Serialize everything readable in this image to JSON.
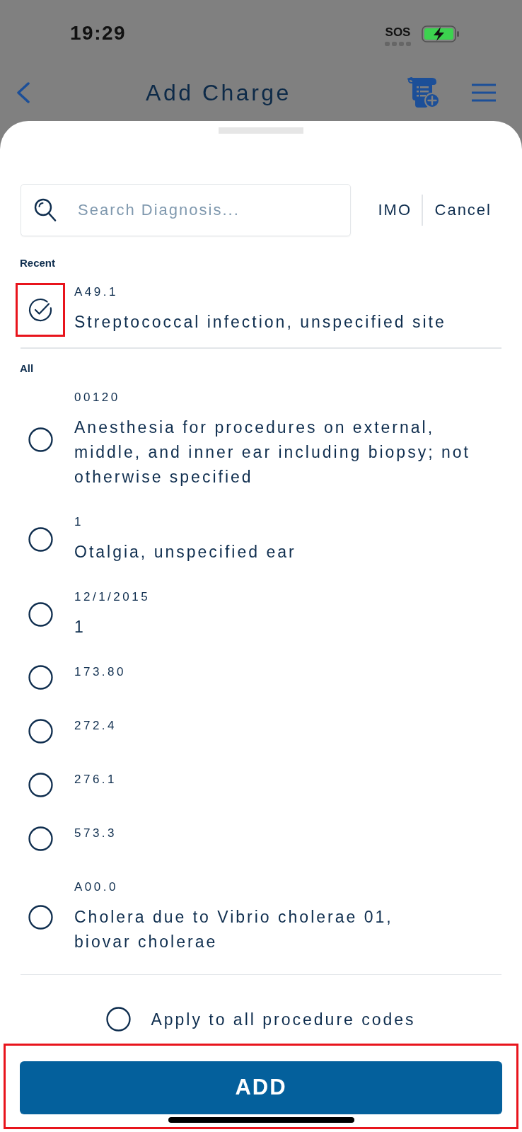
{
  "status_bar": {
    "time": "19:29",
    "sos": "SOS",
    "charging": true
  },
  "header": {
    "title": "Add Charge"
  },
  "search": {
    "placeholder": "Search Diagnosis...",
    "actions": [
      "IMO",
      "Cancel"
    ]
  },
  "sections": [
    {
      "title": "Recent",
      "items": [
        {
          "code": "A49.1",
          "description": "Streptococcal infection, unspecified site",
          "selected": true,
          "highlighted": true
        }
      ]
    },
    {
      "title": "All",
      "items": [
        {
          "code": "00120",
          "description": "Anesthesia for procedures on external, middle, and inner ear including biopsy; not otherwise specified",
          "selected": false,
          "highlighted": false
        },
        {
          "code": "1",
          "description": "Otalgia, unspecified ear",
          "selected": false,
          "highlighted": false
        },
        {
          "code": "12/1/2015",
          "description": "1",
          "selected": false,
          "highlighted": false
        },
        {
          "code": "173.80",
          "selected": false,
          "highlighted": false
        },
        {
          "code": "272.4",
          "selected": false,
          "highlighted": false
        },
        {
          "code": "276.1",
          "selected": false,
          "highlighted": false
        },
        {
          "code": "573.3",
          "selected": false,
          "highlighted": false
        },
        {
          "code": "A00.0",
          "description": "Cholera due to Vibrio cholerae 01,\nbiovar cholerae",
          "selected": false,
          "highlighted": false
        }
      ]
    }
  ],
  "apply_all": {
    "label": "Apply to all procedure codes",
    "checked": false
  },
  "add_button": {
    "label": "ADD",
    "highlighted": true
  }
}
